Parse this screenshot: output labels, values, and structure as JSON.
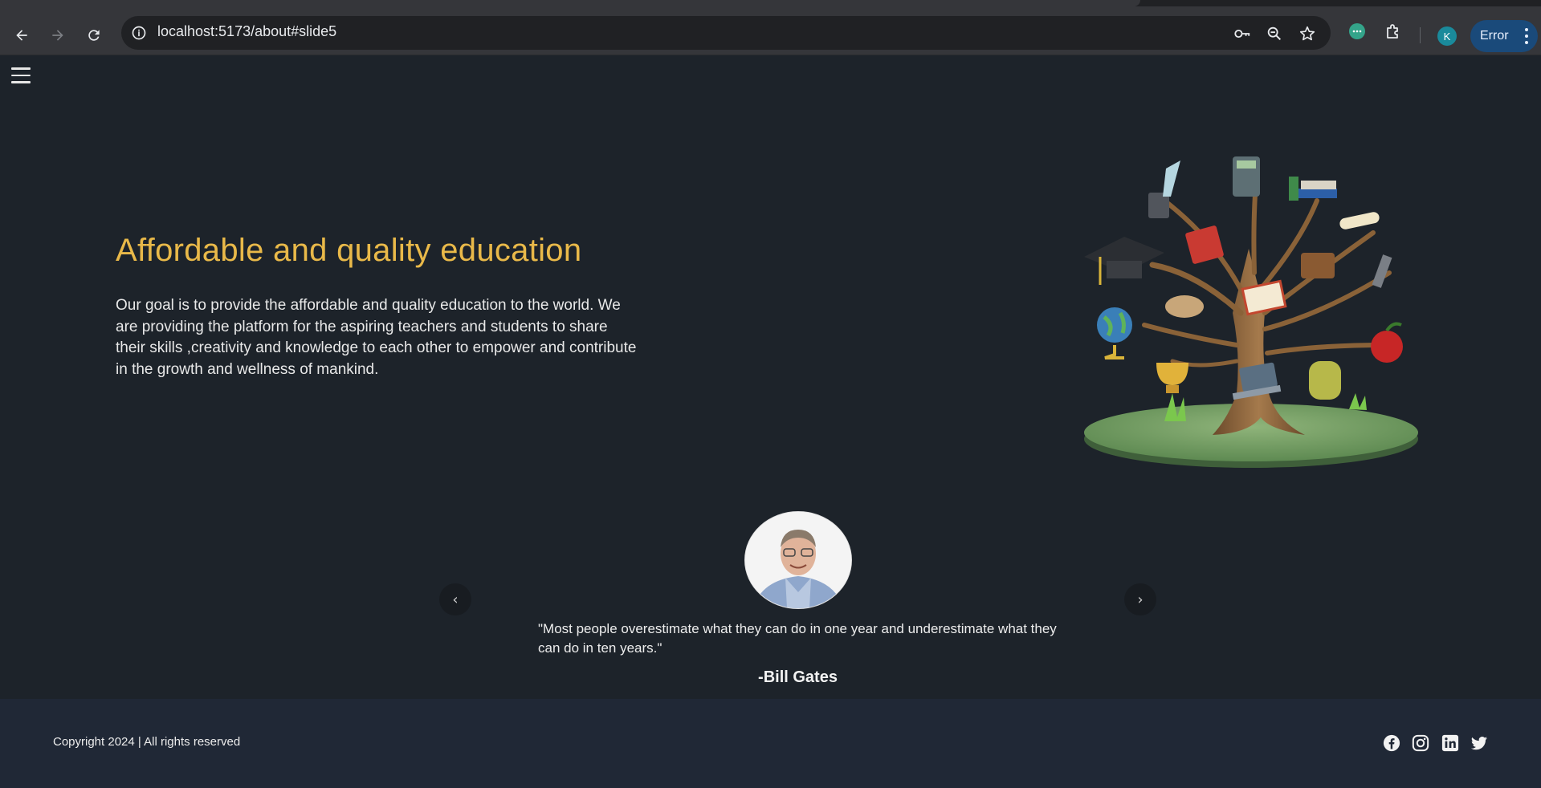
{
  "browser": {
    "url": "localhost:5173/about#slide5",
    "profile_initial": "K",
    "error_label": "Error",
    "icons": [
      "back-icon",
      "forward-icon",
      "reload-icon",
      "site-info-icon",
      "password-key-icon",
      "zoom-icon",
      "bookmark-star-icon",
      "extension-chat-icon",
      "extensions-puzzle-icon",
      "more-vert-icon"
    ]
  },
  "hero": {
    "title": "Affordable and quality education",
    "body": "Our goal is to provide the affordable and quality education to the world. We are providing the platform for the aspiring teachers and students to share their skills ,creativity and knowledge to each other to empower and contribute in the growth and wellness of mankind."
  },
  "testimonial": {
    "quote": "\"Most people overestimate what they can do in one year and underestimate what they can do in ten years.\"",
    "author": "-Bill Gates",
    "prev_glyph": "‹",
    "next_glyph": "›"
  },
  "footer": {
    "copyright": "Copyright 2024 | All rights reserved",
    "social": [
      "facebook-icon",
      "instagram-icon",
      "linkedin-icon",
      "twitter-icon"
    ]
  },
  "colors": {
    "page_bg": "#1d232a",
    "accent": "#e9b949",
    "footer_bg": "#202836"
  }
}
